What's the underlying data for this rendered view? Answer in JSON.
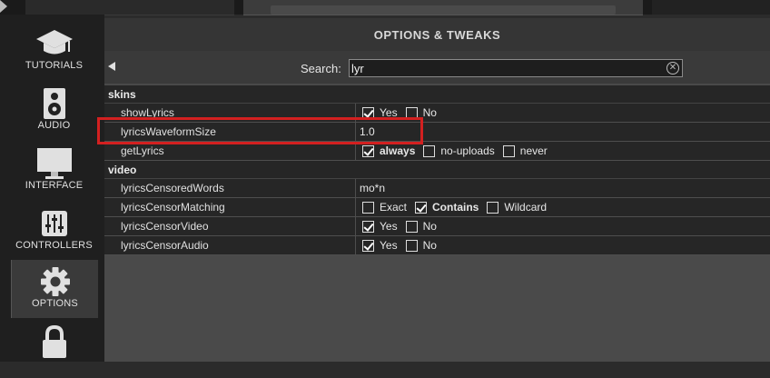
{
  "panel": {
    "title": "OPTIONS & TWEAKS"
  },
  "search": {
    "label": "Search:",
    "value": "lyr"
  },
  "sidebar": {
    "items": [
      {
        "label": "TUTORIALS",
        "icon": "graduation-cap-icon"
      },
      {
        "label": "AUDIO",
        "icon": "speaker-icon"
      },
      {
        "label": "INTERFACE",
        "icon": "monitor-icon"
      },
      {
        "label": "CONTROLLERS",
        "icon": "sliders-icon"
      },
      {
        "label": "OPTIONS",
        "icon": "gear-icon",
        "active": true
      },
      {
        "label": "",
        "icon": "lock-icon"
      }
    ]
  },
  "table": {
    "skins": {
      "title": "skins",
      "rows": [
        {
          "name": "showLyrics",
          "options": [
            {
              "label": "Yes",
              "checked": true
            },
            {
              "label": "No",
              "checked": false
            }
          ]
        },
        {
          "name": "lyricsWaveformSize",
          "value": "1.0"
        },
        {
          "name": "getLyrics",
          "options": [
            {
              "label": "always",
              "checked": true
            },
            {
              "label": "no-uploads",
              "checked": false
            },
            {
              "label": "never",
              "checked": false
            }
          ]
        }
      ]
    },
    "video": {
      "title": "video",
      "rows": [
        {
          "name": "lyricsCensoredWords",
          "value": "mo*n"
        },
        {
          "name": "lyricsCensorMatching",
          "options": [
            {
              "label": "Exact",
              "checked": false
            },
            {
              "label": "Contains",
              "checked": true
            },
            {
              "label": "Wildcard",
              "checked": false
            }
          ]
        },
        {
          "name": "lyricsCensorVideo",
          "options": [
            {
              "label": "Yes",
              "checked": true
            },
            {
              "label": "No",
              "checked": false
            }
          ]
        },
        {
          "name": "lyricsCensorAudio",
          "options": [
            {
              "label": "Yes",
              "checked": true
            },
            {
              "label": "No",
              "checked": false
            }
          ]
        }
      ]
    }
  },
  "colors": {
    "highlight": "#d32020",
    "panel": "#4a4a4a",
    "row": "#262626"
  }
}
